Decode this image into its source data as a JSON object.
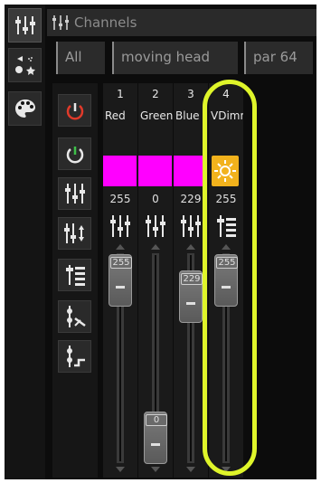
{
  "window": {
    "title": "Channels"
  },
  "tabs": [
    {
      "label": "All"
    },
    {
      "label": "moving head"
    },
    {
      "label": "par 64"
    }
  ],
  "tools": [
    {
      "name": "power-red-icon"
    },
    {
      "name": "power-green-icon"
    },
    {
      "name": "sliders-icon"
    },
    {
      "name": "sliders-updown-icon"
    },
    {
      "name": "list-icon"
    },
    {
      "name": "scissors-icon"
    },
    {
      "name": "scissors-step-icon"
    }
  ],
  "channels": [
    {
      "num": "1",
      "name": "Red",
      "value": "255",
      "fader_level": 255,
      "color": "#ff00ff",
      "fader_label": "255"
    },
    {
      "num": "2",
      "name": "Green",
      "value": "0",
      "fader_level": 0,
      "color": "#ff00ff",
      "fader_label": "0"
    },
    {
      "num": "3",
      "name": "Blue",
      "value": "229",
      "fader_level": 229,
      "color": "#ff00ff",
      "fader_label": "229"
    },
    {
      "num": "4",
      "name": "VDimmer",
      "value": "255",
      "fader_level": 255,
      "color": "#f2b21c",
      "fader_label": "255"
    }
  ],
  "colors": {
    "highlight": "#dff52a",
    "magenta": "#ff00ff",
    "dimmer": "#f2b21c"
  }
}
